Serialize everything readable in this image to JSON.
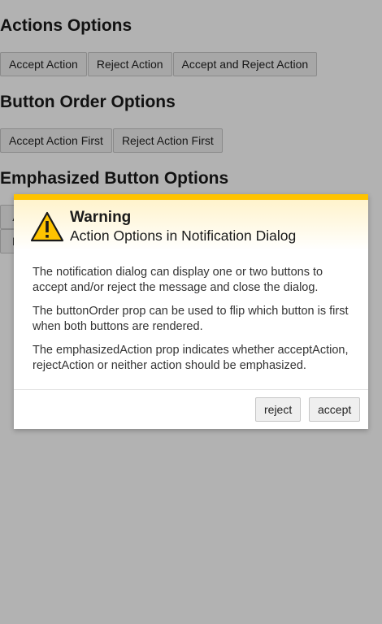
{
  "sections": [
    {
      "title": "Actions Options",
      "buttons": [
        "Accept Action",
        "Reject Action",
        "Accept and Reject Action"
      ]
    },
    {
      "title": "Button Order Options",
      "buttons": [
        "Accept Action First",
        "Reject Action First"
      ]
    },
    {
      "title": "Emphasized Button Options",
      "buttons_partial": [
        "A",
        "N"
      ]
    }
  ],
  "dialog": {
    "kind": "Warning",
    "title": "Action Options in Notification Dialog",
    "icon": "warning-triangle-icon",
    "paragraphs": [
      "The notification dialog can display one or two buttons to accept and/or reject the message and close the dialog.",
      "The buttonOrder prop can be used to flip which button is first when both buttons are rendered.",
      "The emphasizedAction prop indicates whether acceptAction, rejectAction or neither action should be emphasized."
    ],
    "reject_label": "reject",
    "accept_label": "accept"
  },
  "colors": {
    "warning_accent": "#fec300",
    "overlay": "rgba(0,0,0,0.3)"
  }
}
